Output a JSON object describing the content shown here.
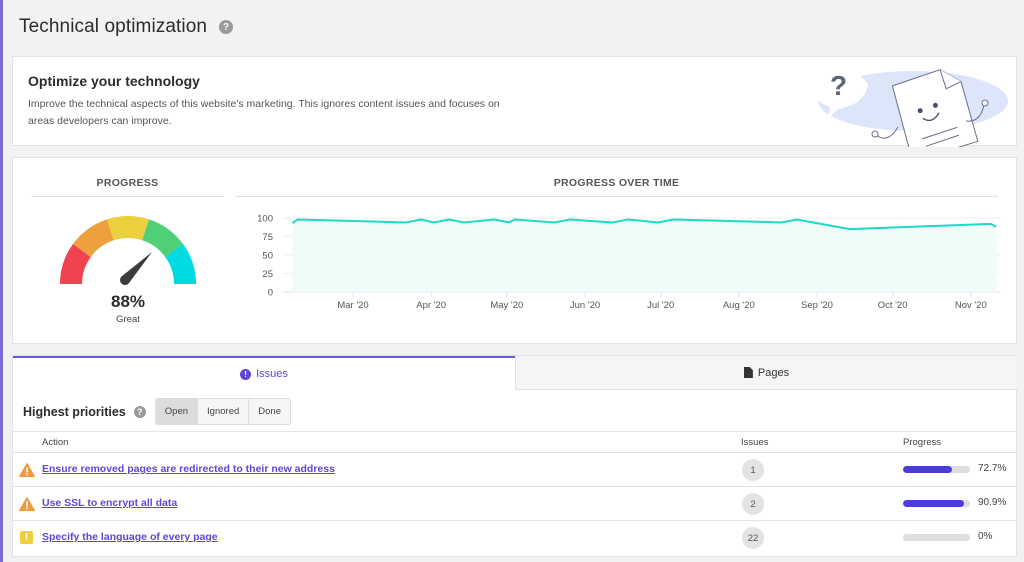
{
  "page": {
    "title": "Technical optimization",
    "help_icon": "question-circle-icon"
  },
  "intro": {
    "heading": "Optimize your technology",
    "description": "Improve the technical aspects of this website's marketing. This ignores content issues and focuses on areas developers can improve.",
    "illustration": "document-mascot-question-illustration"
  },
  "progress": {
    "title": "PROGRESS",
    "value": 88,
    "value_label": "88%",
    "rating": "Great",
    "segment_colors": [
      "#f0434f",
      "#ee9f3e",
      "#edd03d",
      "#4fcf76",
      "#00dbe2"
    ]
  },
  "colors": {
    "accent": "#5b48d8",
    "line": "#1ed9c3",
    "progress_fill": "#4c3ddb",
    "warning": "#ef9a3c",
    "caution": "#f0cf3b"
  },
  "chart_data": {
    "type": "area",
    "title": "PROGRESS OVER TIME",
    "xlabel": "",
    "ylabel": "",
    "ylim": [
      0,
      100
    ],
    "yticks": [
      0,
      25,
      50,
      75,
      100
    ],
    "grid": true,
    "legend": "none",
    "xtick_labels": [
      "Mar '20",
      "Apr '20",
      "May '20",
      "Jun '20",
      "Jul '20",
      "Aug '20",
      "Sep '20",
      "Oct '20",
      "Nov '20"
    ],
    "series": [
      {
        "name": "Progress",
        "points": [
          [
            "2020-02-06",
            93
          ],
          [
            "2020-02-08",
            98
          ],
          [
            "2020-03-22",
            94
          ],
          [
            "2020-03-28",
            98
          ],
          [
            "2020-04-02",
            94
          ],
          [
            "2020-04-08",
            98
          ],
          [
            "2020-04-14",
            94
          ],
          [
            "2020-04-26",
            98
          ],
          [
            "2020-05-02",
            94
          ],
          [
            "2020-05-04",
            98
          ],
          [
            "2020-05-20",
            94
          ],
          [
            "2020-05-26",
            98
          ],
          [
            "2020-06-12",
            94
          ],
          [
            "2020-06-18",
            98
          ],
          [
            "2020-06-30",
            94
          ],
          [
            "2020-07-06",
            98
          ],
          [
            "2020-08-18",
            94
          ],
          [
            "2020-08-24",
            98
          ],
          [
            "2020-09-14",
            85
          ],
          [
            "2020-11-09",
            92
          ],
          [
            "2020-11-11",
            88
          ]
        ]
      }
    ]
  },
  "tabs": [
    {
      "label": "Issues",
      "icon": "exclamation-circle-icon",
      "active": true
    },
    {
      "label": "Pages",
      "icon": "file-icon",
      "active": false
    }
  ],
  "priorities": {
    "title": "Highest priorities",
    "filters": [
      {
        "label": "Open",
        "active": true
      },
      {
        "label": "Ignored",
        "active": false
      },
      {
        "label": "Done",
        "active": false
      }
    ],
    "columns": {
      "action": "Action",
      "issues": "Issues",
      "progress": "Progress"
    },
    "rows": [
      {
        "icon": "warning-triangle-icon",
        "action": "Ensure removed pages are redirected to their new address",
        "issues": "1",
        "progress": 72.7,
        "progress_label": "72.7%"
      },
      {
        "icon": "warning-triangle-icon",
        "action": "Use SSL to encrypt all data",
        "issues": "2",
        "progress": 90.9,
        "progress_label": "90.9%"
      },
      {
        "icon": "exclamation-square-icon",
        "action": "Specify the language of every page",
        "issues": "22",
        "progress": 0,
        "progress_label": "0%"
      }
    ]
  }
}
